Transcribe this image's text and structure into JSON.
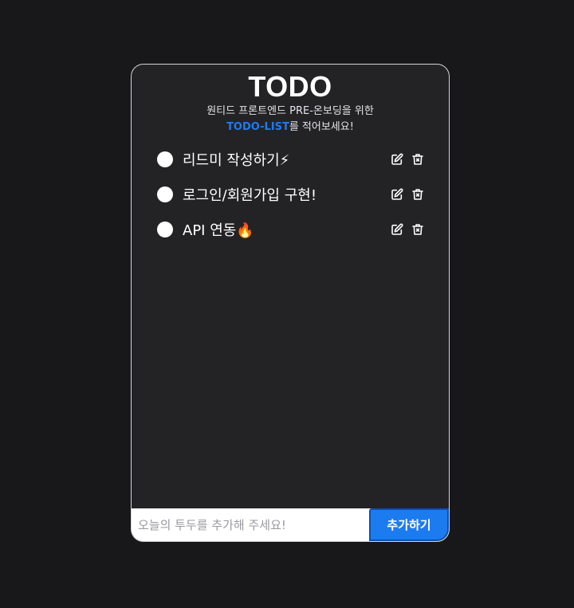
{
  "header": {
    "title": "TODO",
    "subtitle_line1": "원티드 프론트엔드 PRE-온보딩을 위한",
    "subtitle_accent": "TODO-LIST",
    "subtitle_rest": "를 적어보세요!"
  },
  "todos": [
    {
      "text": "리드미 작성하기⚡",
      "done": false
    },
    {
      "text": "로그인/회원가입 구현!",
      "done": false
    },
    {
      "text": "API 연동🔥",
      "done": false
    }
  ],
  "icons": {
    "edit": "edit-icon",
    "delete": "trash-icon"
  },
  "form": {
    "placeholder": "오늘의 투두를 추가해 주세요!",
    "value": "",
    "button_label": "추가하기"
  },
  "colors": {
    "background": "#18181b",
    "card": "#232326",
    "accent": "#1d7bf0",
    "text": "#ffffff"
  }
}
